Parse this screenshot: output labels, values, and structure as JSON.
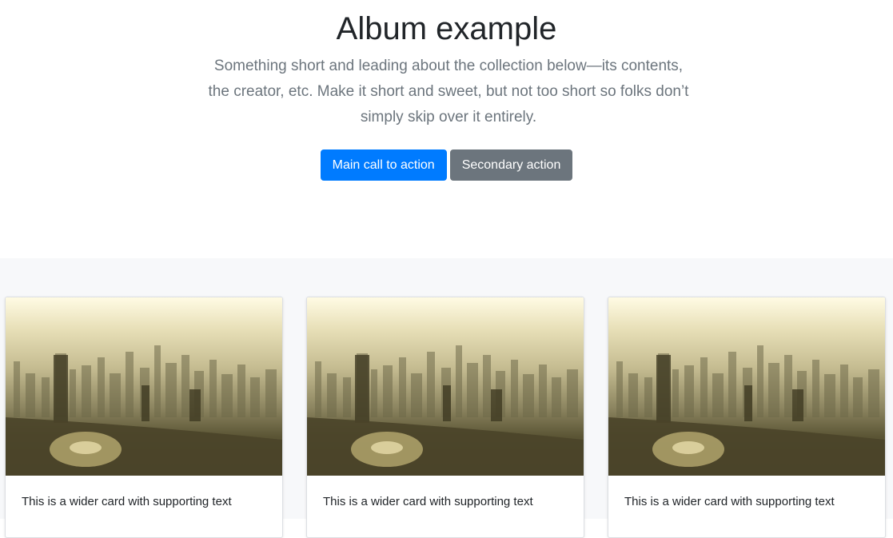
{
  "hero": {
    "title": "Album example",
    "lead": "Something short and leading about the collection below—its contents, the creator, etc. Make it short and sweet, but not too short so folks don’t simply skip over it entirely.",
    "primary_label": "Main call to action",
    "secondary_label": "Secondary action"
  },
  "colors": {
    "primary": "#007bff",
    "secondary": "#6c757d",
    "album_bg": "#f7f8fa"
  },
  "cards": [
    {
      "image": "hazy-city-skyline-photo",
      "text": "This is a wider card with supporting text"
    },
    {
      "image": "hazy-city-skyline-photo",
      "text": "This is a wider card with supporting text"
    },
    {
      "image": "hazy-city-skyline-photo",
      "text": "This is a wider card with supporting text"
    }
  ]
}
